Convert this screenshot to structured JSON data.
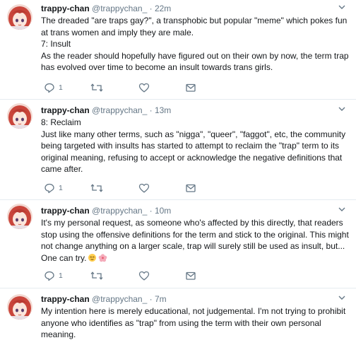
{
  "colors": {
    "text": "#14171a",
    "muted": "#657786",
    "divider": "#e6ecf0",
    "avatar_hair": "#c9453b",
    "avatar_bg": "#f5d7cf"
  },
  "tweets": [
    {
      "name": "trappy-chan",
      "handle": "@trappychan_",
      "dot": "·",
      "time": "22m",
      "lines": [
        "The dreaded \"are traps gay?\", a transphobic but popular \"meme\" which pokes fun at trans women and imply they are male.",
        "7: Insult",
        "As the reader should hopefully have figured out on their own by now, the term trap has evolved over time to become an insult towards trans girls."
      ],
      "reply_count": "1"
    },
    {
      "name": "trappy-chan",
      "handle": "@trappychan_",
      "dot": "·",
      "time": "13m",
      "lines": [
        "8: Reclaim",
        "Just like many other terms, such as \"nigga\", \"queer\", \"faggot\", etc, the community being targeted with insults has started to attempt to reclaim the \"trap\" term to its original meaning, refusing to accept or acknowledge the negative definitions that came after."
      ],
      "reply_count": "1"
    },
    {
      "name": "trappy-chan",
      "handle": "@trappychan_",
      "dot": "·",
      "time": "10m",
      "lines": [
        "It's my personal request, as someone who's affected by this directly, that readers stop using the offensive definitions for the term and stick to the original. This might not change anything on a larger scale, trap will surely still be used as insult, but... One can try."
      ],
      "reply_count": "1"
    },
    {
      "name": "trappy-chan",
      "handle": "@trappychan_",
      "dot": "·",
      "time": "7m",
      "lines": [
        "My intention here is merely educational, not judgemental. I'm not trying to prohibit anyone who identifies as \"trap\" from using the term with their own personal meaning."
      ],
      "reply_count": ""
    }
  ]
}
